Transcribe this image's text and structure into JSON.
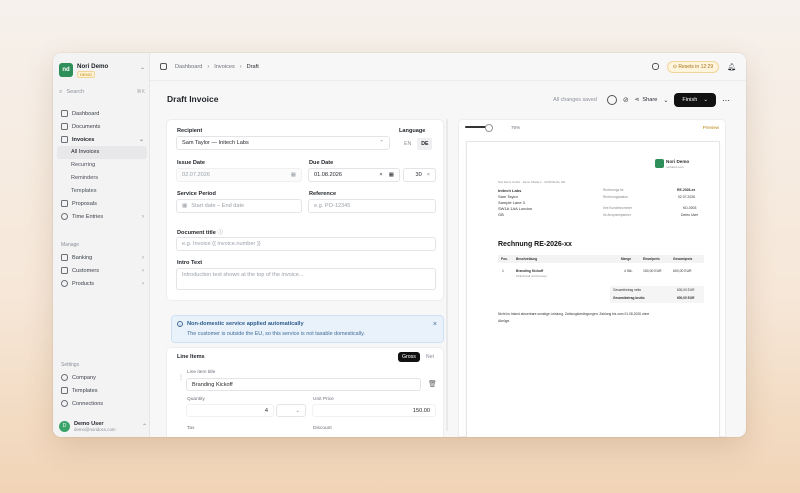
{
  "workspace": {
    "name": "Nori Demo",
    "badge": "DEMO",
    "logo": "nori"
  },
  "search": {
    "label": "Search",
    "shortcut": "⌘K"
  },
  "nav": {
    "dashboard": "Dashboard",
    "documents": "Documents",
    "invoices": "Invoices",
    "all_invoices": "All Invoices",
    "recurring": "Recurring",
    "reminders": "Reminders",
    "templates": "Templates",
    "proposals": "Proposals",
    "time_entries": "Time Entries",
    "manage_title": "Manage",
    "banking": "Banking",
    "customers": "Customers",
    "products": "Products",
    "settings_title": "Settings",
    "company": "Company",
    "templates2": "Templates",
    "connections": "Connections"
  },
  "user": {
    "name": "Demo User",
    "email": "demo@noridocs.com",
    "initials": "D"
  },
  "breadcrumb": {
    "a": "Dashboard",
    "b": "Invoices",
    "c": "Draft"
  },
  "topbar": {
    "resets": "Resets in 12:29"
  },
  "page": {
    "title": "Draft Invoice",
    "saved": "All changes saved",
    "share": "Share",
    "finish": "Finish"
  },
  "form": {
    "recipient_label": "Recipient",
    "recipient_value": "Sam Taylor — Initech Labs",
    "language_label": "Language",
    "lang_en": "EN",
    "lang_de": "DE",
    "issue_label": "Issue Date",
    "issue_value": "02.07.2026",
    "due_label": "Due Date",
    "due_value": "01.08.2026",
    "due_days": "30",
    "period_label": "Service Period",
    "period_ph": "Start date – End date",
    "reference_label": "Reference",
    "reference_ph": "e.g. PO-12345",
    "doctitle_label": "Document title",
    "doctitle_ph": "e.g. Invoice {{ invoice.number }}",
    "intro_label": "Intro Text",
    "intro_ph": "Introduction text shown at the top of the invoice..."
  },
  "notice": {
    "title": "Non-domestic service applied automatically",
    "desc": "The customer is outside the EU, so this service is not taxable domestically."
  },
  "line_items": {
    "title": "Line Items",
    "gross": "Gross",
    "net": "Net",
    "item_title_label": "Line item title",
    "item_title": "Branding Kickoff",
    "quantity_label": "Quantity",
    "quantity": "4",
    "unit_price_label": "Unit Price",
    "unit_price": "150.00",
    "tax_label": "Tax",
    "discount_label": "Discount"
  },
  "preview": {
    "zoom": "76%",
    "label": "Preview",
    "brand": "Nori Demo",
    "brand_sub": "noridocs.com",
    "sender_line": "Nori Demo GmbH · Demo Straße 1 · 10115 Berlin, DE",
    "to1": "Initech Labs",
    "to2": "Sam Taylor",
    "to3": "Sample Lane 3",
    "to4": "SW1A 1AA London",
    "to5": "GB",
    "m1k": "Rechnungs-Nr.",
    "m1v": "RE-2026-xx",
    "m2k": "Rechnungsdatum",
    "m2v": "02.07.2026",
    "m3k": "Ihre Kundennummer",
    "m3v": "KD-0003",
    "m4k": "Ihr Ansprechpartner",
    "m4v": "Demo User",
    "heading": "Rechnung RE-2026-xx",
    "th_pos": "Pos.",
    "th_desc": "Beschreibung",
    "th_qty": "Menge",
    "th_unit": "Einzelpreis",
    "th_total": "Gesamtpreis",
    "r_pos": "1",
    "r_title": "Branding Kickoff",
    "r_sub": "Kickoff-Call und Konzept",
    "r_qty": "4 Stk.",
    "r_unit": "150,00 EUR",
    "r_total": "600,00 EUR",
    "net_k": "Gesamtbetrag netto",
    "net_v": "600,00 EUR",
    "gross_k": "Gesamtbetrag brutto",
    "gross_v": "600,00 EUR",
    "footer1": "Nicht im Inland steuerbare sonstige Leistung. Zahlungsbedingungen: Zahlung bis zum 01.08.2026 ohne",
    "footer2": "Abzüge."
  },
  "colors": {
    "accent": "#111111",
    "brand": "#2f8f5b",
    "notice_bg": "#e9f2fb",
    "resets": "#fff4dc"
  }
}
